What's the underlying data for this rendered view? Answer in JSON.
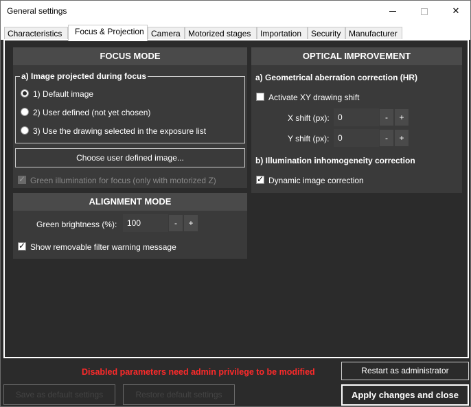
{
  "window": {
    "title": "General settings",
    "close_glyph": "✕"
  },
  "tabs": [
    {
      "label": "Characteristics"
    },
    {
      "label": "Focus & Projection"
    },
    {
      "label": "Camera"
    },
    {
      "label": "Motorized stages"
    },
    {
      "label": "Importation"
    },
    {
      "label": "Security"
    },
    {
      "label": "Manufacturer"
    }
  ],
  "focus_mode": {
    "header": "FOCUS MODE",
    "group_title": "a) Image projected during focus",
    "options": [
      {
        "label": "1) Default image",
        "checked": true
      },
      {
        "label": "2) User defined (not yet chosen)",
        "checked": false
      },
      {
        "label": "3) Use the drawing selected in the exposure list",
        "checked": false
      }
    ],
    "choose_button": "Choose user defined image...",
    "green_illumination_label": "Green illumination for focus (only with motorized Z)",
    "green_illumination_checked": true
  },
  "alignment_mode": {
    "header": "ALIGNMENT MODE",
    "brightness_label": "Green brightness (%):",
    "brightness_value": "100",
    "minus": "-",
    "plus": "+",
    "show_filter_warning_label": "Show removable filter warning message",
    "show_filter_warning_checked": true
  },
  "optical_improvement": {
    "header": "OPTICAL IMPROVEMENT",
    "section_a": "a) Geometrical aberration correction (HR)",
    "activate_shift_label": "Activate XY drawing shift",
    "activate_shift_checked": false,
    "x_shift_label": "X shift (px):",
    "x_shift_value": "0",
    "y_shift_label": "Y shift (px):",
    "y_shift_value": "0",
    "minus": "-",
    "plus": "+",
    "section_b": "b) Illumination inhomogeneity correction",
    "dynamic_correction_label": "Dynamic image correction",
    "dynamic_correction_checked": true
  },
  "footer": {
    "warning": "Disabled parameters need admin privilege to be modified",
    "restart_admin": "Restart as administrator",
    "save_default": "Save as default settings",
    "restore_default": "Restore default settings",
    "apply_close": "Apply changes and close"
  },
  "colors": {
    "background": "#2b2b2b",
    "panel": "#3a3a3a",
    "panel_header": "#4a4a4a",
    "warning": "#ff2a2a"
  }
}
